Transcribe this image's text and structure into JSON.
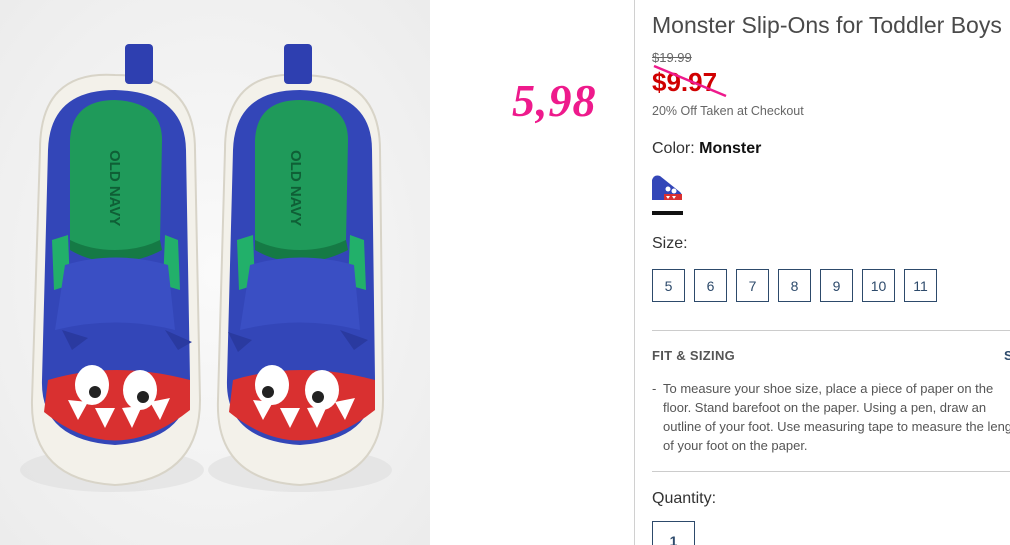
{
  "product": {
    "title": "Monster Slip-Ons for Toddler Boys",
    "original_price": "$19.99",
    "sale_price": "$9.97",
    "promo": "20% Off Taken at Checkout",
    "brand_print": "OLD NAVY"
  },
  "annotation": {
    "text": "5,98",
    "color": "#ee1a8c"
  },
  "color": {
    "label": "Color:",
    "value": "Monster"
  },
  "size": {
    "label": "Size:",
    "options": [
      "5",
      "6",
      "7",
      "8",
      "9",
      "10",
      "11"
    ]
  },
  "fit_sizing": {
    "title": "FIT & SIZING",
    "link": "S",
    "dash": "-",
    "text": "To measure your shoe size, place a piece of paper on the floor. Stand barefoot on the paper. Using a pen, draw an outline of your foot. Use measuring tape to measure the length of your foot on the paper."
  },
  "quantity": {
    "label": "Quantity:",
    "value": "1"
  },
  "colors": {
    "sale_red": "#d00000",
    "accent_navy": "#2d4a6b",
    "shoe_blue": "#3346b8"
  }
}
